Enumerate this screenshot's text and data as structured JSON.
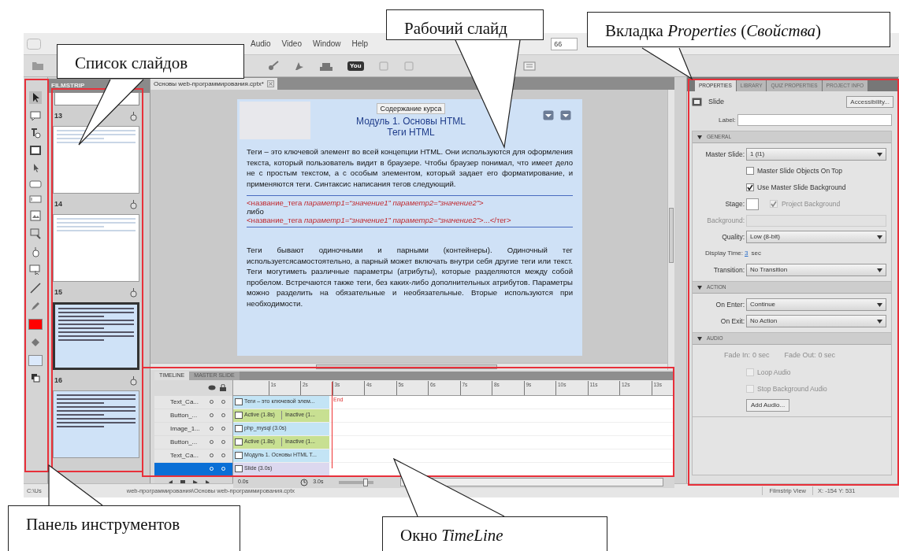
{
  "menu": {
    "items": [
      "Audio",
      "Video",
      "Window",
      "Help"
    ],
    "zoom_field": "66"
  },
  "toolbar": {
    "logo_text": "You"
  },
  "filmstrip": {
    "title": "FILMSTRIP",
    "slides": [
      {
        "number": "13",
        "kind": "screen",
        "selected": false
      },
      {
        "number": "14",
        "kind": "screen",
        "selected": false
      },
      {
        "number": "15",
        "kind": "text",
        "selected": true
      },
      {
        "number": "16",
        "kind": "text",
        "selected": false
      }
    ]
  },
  "document_tab": {
    "title": "Основы web-программирования.cptx*",
    "selected": true
  },
  "slide": {
    "button": "Содержание курса",
    "title": "Модуль 1. Основы HTML",
    "subtitle": "Теги HTML",
    "paragraph_1": "Теги – это ключевой элемент во всей концепции HTML. Они используются для оформления текста, который пользователь видит в браузере. Чтобы браузер понимал, что имеет дело не с простым текстом, а с особым элементом, который задает его форматирование, и применяются теги. Синтаксис написания тегов следующий.",
    "syntax": [
      "<название_тега *параметр1=“значение1” параметр2=“значение2”*>",
      "либо",
      "<название_тега *параметр1=“значение1” параметр2=“значение2”*>...</тег>"
    ],
    "paragraph_2": "Теги бывают одиночными и парными (контейнеры). Одиночный тег используетсясамостоятельно, а парный может включать внутри себя другие теги или текст. Теги могутиметь различные параметры (атрибуты), которые разделяются между собой пробелом. Встречаются также теги, без каких-либо дополнительных атрибутов. Параметры можно разделить на обязательные и необязательные. Вторые используются при необходимости."
  },
  "timeline": {
    "tabs": [
      {
        "label": "TIMELINE",
        "selected": true
      },
      {
        "label": "MASTER SLIDE",
        "selected": false
      }
    ],
    "ruler": [
      "1s",
      "2s",
      "3s",
      "4s",
      "5s",
      "6s",
      "7s",
      "8s",
      "9s",
      "10s",
      "11s",
      "12s",
      "13s"
    ],
    "end_label": "End",
    "layers": [
      {
        "name": "Text_Ca...",
        "kind": "text",
        "bar": "Теги – это ключевой элем...",
        "selected": false
      },
      {
        "name": "Button_...",
        "kind": "button",
        "bar": "Active (1.8s)",
        "bar_2": "Inactive (1...",
        "selected": false
      },
      {
        "name": "Image_1...",
        "kind": "image",
        "bar": "php_mysql (3.0s)",
        "selected": false
      },
      {
        "name": "Button_...",
        "kind": "button",
        "bar": "Active (1.8s)",
        "bar_2": "Inactive (1...",
        "selected": false
      },
      {
        "name": "Text_Ca...",
        "kind": "text",
        "bar": "Модуль 1. Основы HTML T...",
        "selected": false
      },
      {
        "kind": "slide",
        "bar": "Slide (3.0s)",
        "selected": true
      }
    ],
    "time": "0.0s",
    "duration": "3.0s",
    "zoom_slider": {
      "level": 0.8
    }
  },
  "properties": {
    "tabs": [
      {
        "label": "PROPERTIES",
        "selected": true
      },
      {
        "label": "LIBRARY",
        "selected": false
      },
      {
        "label": "QUIZ PROPERTIES",
        "selected": false
      },
      {
        "label": "PROJECT INFO",
        "selected": false
      }
    ],
    "object_type": "Slide",
    "accessibility_button": "Accessibility...",
    "label_field": "Label:",
    "sections": [
      {
        "title": "GENERAL",
        "expanded": true,
        "rows": [
          {
            "kind": "select",
            "label": "Master Slide:",
            "value": "1 (l1)"
          },
          {
            "kind": "checkbox",
            "label": "Master Slide Objects On Top",
            "checked": false,
            "disabled": false
          },
          {
            "kind": "checkbox",
            "label": "Use Master Slide Background",
            "checked": true,
            "disabled": false
          },
          {
            "kind": "stage",
            "label": "Stage:",
            "checkbox_label": "Project Background",
            "checked": true,
            "disabled": true
          },
          {
            "kind": "field",
            "label": "Background:",
            "disabled": true
          },
          {
            "kind": "select",
            "label": "Quality:",
            "value": "Low (8-bit)"
          },
          {
            "kind": "time",
            "label": "Display Time:",
            "value": "3",
            "unit": "sec"
          },
          {
            "kind": "select",
            "label": "Transition:",
            "value": "No Transition"
          }
        ]
      },
      {
        "title": "ACTION",
        "expanded": true,
        "rows": [
          {
            "kind": "select",
            "label": "On Enter:",
            "value": "Continue"
          },
          {
            "kind": "select",
            "label": "On Exit:",
            "value": "No Action"
          }
        ]
      },
      {
        "title": "AUDIO",
        "expanded": true,
        "rows": [
          {
            "kind": "fade",
            "label": "Fade In:",
            "value": "0 sec",
            "label_2": "Fade Out:",
            "value_2": "0 sec",
            "disabled": true
          },
          {
            "kind": "checkbox",
            "label": "Loop Audio",
            "checked": false,
            "disabled": true
          },
          {
            "kind": "checkbox",
            "label": "Stop Background Audio",
            "checked": false,
            "disabled": true
          },
          {
            "kind": "button",
            "label": "Add Audio..."
          }
        ]
      }
    ]
  },
  "status_bar": {
    "path_start": "C:\\Us",
    "path_end": "web-программирования\\Основы web-программирования.cptx",
    "view": "Filmstrip View",
    "coordinates": "X: -154 Y: 531"
  },
  "callouts": [
    {
      "text": "Список слайдов"
    },
    {
      "text": "Рабочий слайд"
    },
    {
      "text": "Вкладка *Properties* (*Свойства*)"
    },
    {
      "text": "Панель инструментов"
    },
    {
      "text": "Окно *TimeLine*"
    }
  ]
}
